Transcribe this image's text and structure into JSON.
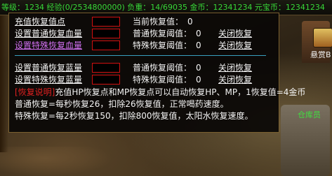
{
  "top_bar": {
    "text": "等级：1234 经验(0/2534800000) 负重：14/69035 金币：12341234 元宝币：12341234",
    "colors": {
      "text": "#38d838"
    }
  },
  "npc_labels": {
    "right_top": "悬赏B",
    "right_bottom": "仓库员"
  },
  "dialog": {
    "hp_section": {
      "recharge_link": "充值恢复值点",
      "current_label": "当前恢复值：",
      "current_value": "0",
      "normal_hp_link": "设置普通恢复血量",
      "normal_threshold_label": "普通恢复阈值：",
      "normal_threshold_value": "0",
      "normal_close_link": "关闭恢复",
      "special_hp_link": "设置特殊恢复血量",
      "special_threshold_label": "特殊恢复阈值：",
      "special_threshold_value": "0",
      "special_close_link": "关闭恢复"
    },
    "mp_section": {
      "normal_mp_link": "设置普通恢复蓝量",
      "normal_threshold_label": "普通恢复阈值：",
      "normal_threshold_value": "0",
      "normal_close_link": "关闭恢复",
      "special_mp_link": "设置特殊恢复蓝量",
      "special_threshold_label": "特殊恢复阈值：",
      "special_threshold_value": "0",
      "special_close_link": "关闭恢复"
    },
    "description": {
      "tag": "[恢复说明]",
      "line1": "充值HP恢复点和MP恢复点可以自动恢复HP、MP，1恢复值=4金币",
      "line2": "普通恢复=每秒恢复26，扣除26恢复值，正常喝药速度。",
      "line3": "特殊恢复=每2秒恢复150，扣除800恢复值，太阳水恢复速度。"
    }
  },
  "colors": {
    "link": "#f4f4f4",
    "link_highlight": "#d070f0",
    "input_border": "#d01010",
    "separator": "#38a0c0",
    "note_tag": "#e02020"
  }
}
